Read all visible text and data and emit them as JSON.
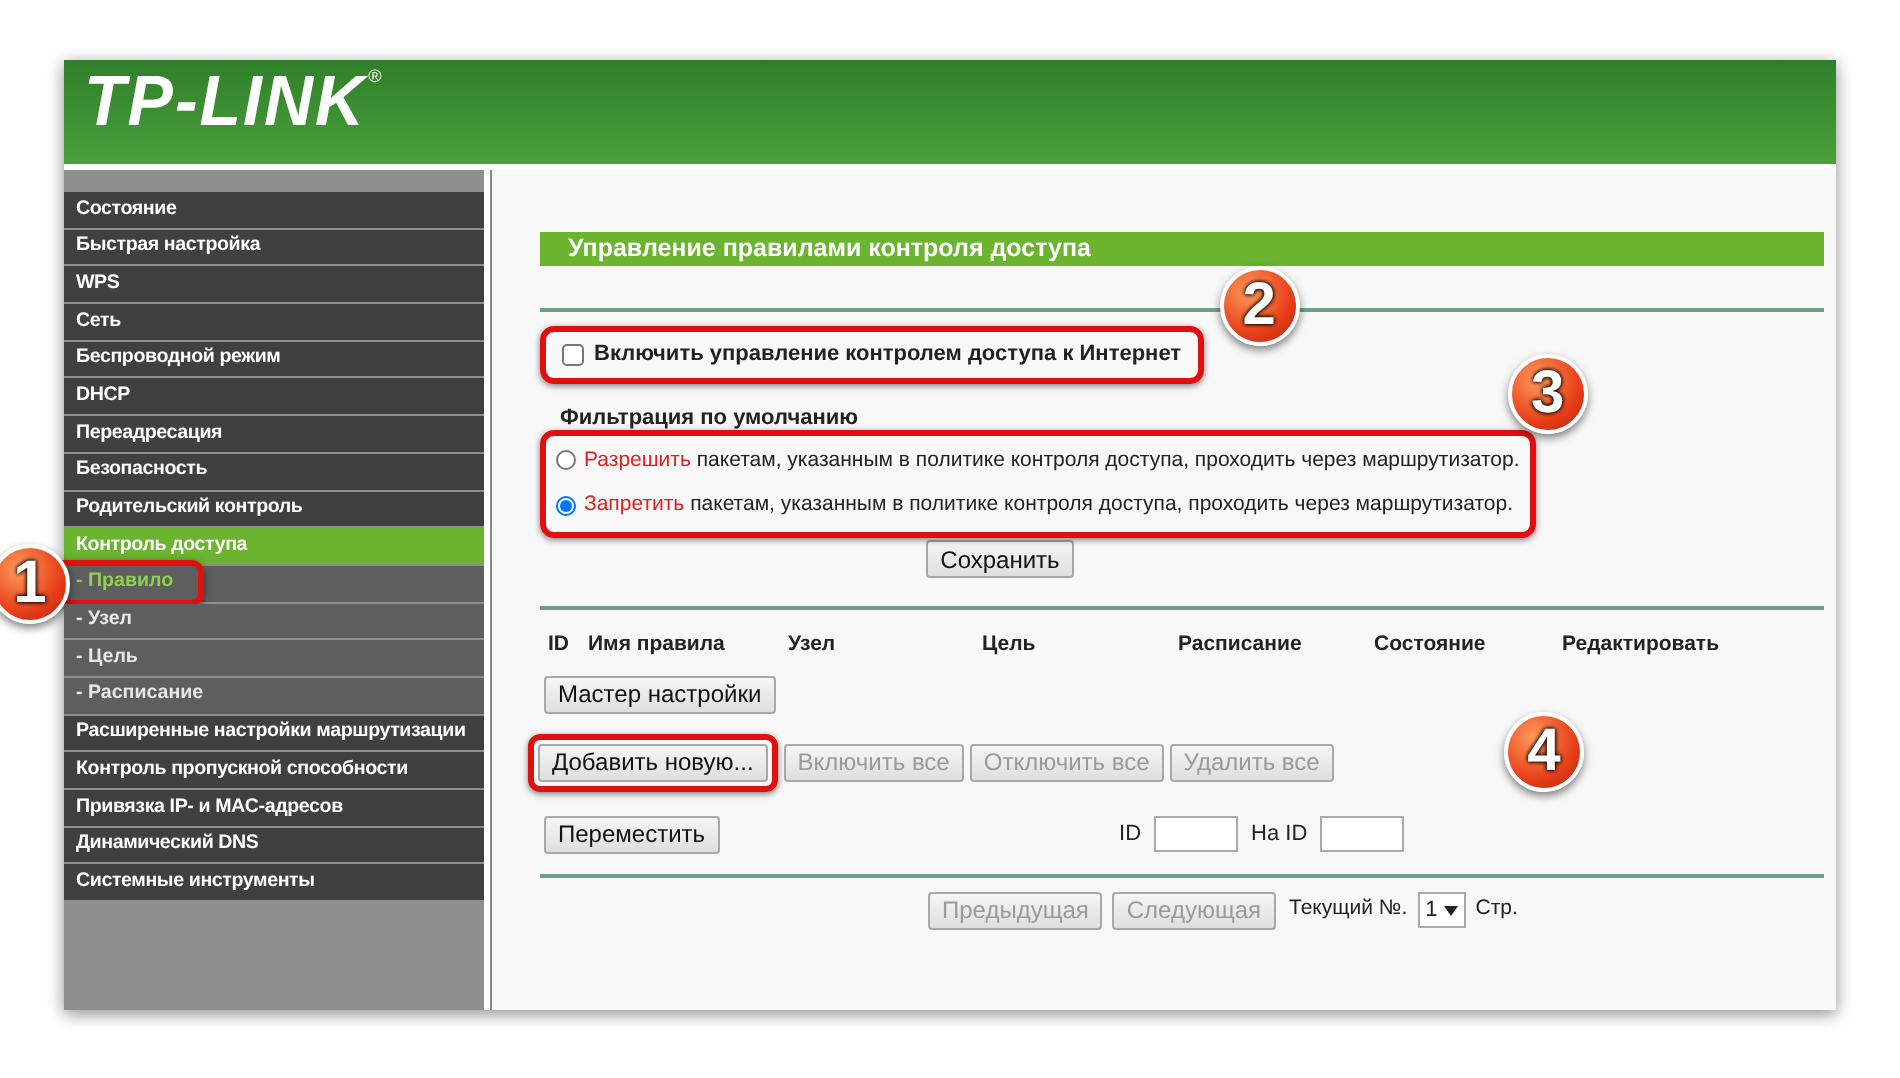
{
  "header": {
    "logo": "TP-LINK",
    "logo_mark": "®"
  },
  "sidebar": {
    "items": [
      {
        "label": "Состояние",
        "selected": false
      },
      {
        "label": "Быстрая настройка",
        "selected": false
      },
      {
        "label": "WPS",
        "selected": false
      },
      {
        "label": "Сеть",
        "selected": false
      },
      {
        "label": "Беспроводной режим",
        "selected": false
      },
      {
        "label": "DHCP",
        "selected": false
      },
      {
        "label": "Переадресация",
        "selected": false
      },
      {
        "label": "Безопасность",
        "selected": false
      },
      {
        "label": "Родительский контроль",
        "selected": false
      },
      {
        "label": "Контроль доступа",
        "selected": true,
        "children": [
          {
            "label": "- Правило",
            "selected": true,
            "highlighted": true,
            "annotation": "1"
          },
          {
            "label": "- Узел",
            "selected": false,
            "highlighted": false
          },
          {
            "label": "- Цель",
            "selected": false,
            "highlighted": false
          },
          {
            "label": "- Расписание",
            "selected": false,
            "highlighted": false
          }
        ]
      },
      {
        "label": "Расширенные настройки маршрутизации",
        "selected": false
      },
      {
        "label": "Контроль пропускной способности",
        "selected": false
      },
      {
        "label": "Привязка IP- и MAC-адресов",
        "selected": false
      },
      {
        "label": "Динамический DNS",
        "selected": false
      },
      {
        "label": "Системные инструменты",
        "selected": false
      }
    ]
  },
  "content": {
    "title": "Управление правилами контроля доступа",
    "enable": {
      "label": "Включить управление контролем доступа к Интернет",
      "checked": false,
      "highlighted": true,
      "annotation": "2"
    },
    "filter": {
      "label": "Фильтрация по умолчанию",
      "highlighted": true,
      "annotation": "3",
      "options": [
        {
          "verb": "Разрешить",
          "text": "пакетам, указанным в политике контроля доступа, проходить через маршрутизатор.",
          "selected": false
        },
        {
          "verb": "Запретить",
          "text": "пакетам, указанным в политике контроля доступа, проходить через маршрутизатор.",
          "selected": true
        }
      ]
    },
    "save_button": "Сохранить",
    "table": {
      "columns": [
        "ID",
        "Имя правила",
        "Узел",
        "Цель",
        "Расписание",
        "Состояние",
        "Редактировать"
      ]
    },
    "wizard_button": "Мастер настройки",
    "actions": [
      {
        "label": "Добавить новую...",
        "disabled": false,
        "highlighted": true,
        "annotation": "4"
      },
      {
        "label": "Включить все",
        "disabled": true,
        "highlighted": false
      },
      {
        "label": "Отключить все",
        "disabled": true,
        "highlighted": false
      },
      {
        "label": "Удалить все",
        "disabled": true,
        "highlighted": false
      }
    ],
    "move": {
      "button": "Переместить",
      "from_label": "ID",
      "to_label": "На ID"
    },
    "pagination": {
      "prev": {
        "label": "Предыдущая",
        "disabled": true
      },
      "next": {
        "label": "Следующая",
        "disabled": true
      },
      "current_label": "Текущий №.",
      "page": "1",
      "page_suffix": "Стр."
    }
  }
}
